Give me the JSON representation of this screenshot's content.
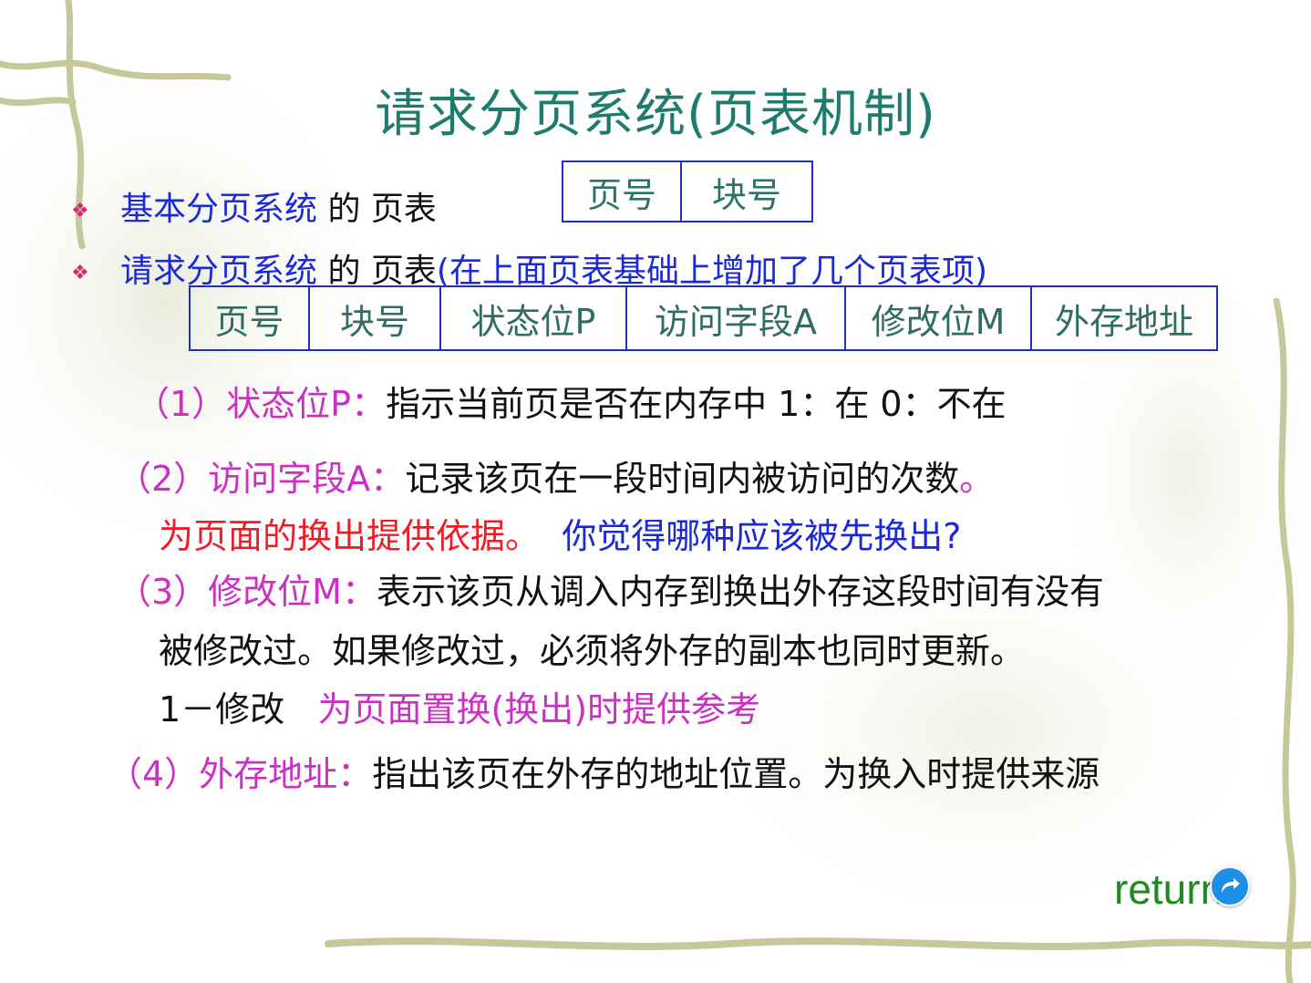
{
  "title": "请求分页系统(页表机制)",
  "bullets": [
    {
      "name": "基本分页系统",
      "connector": " 的 ",
      "item": "页表",
      "note": ""
    },
    {
      "name": "请求分页系统",
      "connector": " 的 ",
      "item": "页表",
      "note": "(在上面页表基础上增加了几个页表项)"
    }
  ],
  "basic_table": [
    "页号",
    "块号"
  ],
  "request_table": [
    "页号",
    "块号",
    "状态位P",
    "访问字段A",
    "修改位M",
    "外存地址"
  ],
  "items": {
    "p1_label": "（1）状态位P：",
    "p1_text": "指示当前页是否在内存中  1：在   0：不在",
    "p2_label": "（2）访问字段A：",
    "p2_text": "记录该页在一段时间内被访问的次数",
    "p2_end": "。",
    "p2_red": "为页面的换出提供依据。",
    "p2_blue": "你觉得哪种应该被先换出?",
    "p3_label": "（3）修改位M：",
    "p3_text1": "表示该页从调入内存到换出外存这段时间有没有",
    "p3_text2": "被修改过。如果修改过，必须将外存的副本也同时更新。",
    "p3_text3": "1－修改",
    "p3_magenta": "为页面置换(换出)时提供参考",
    "p4_label": "（4）外存地址：",
    "p4_text": "指出该页在外存的地址位置。为换入时提供来源"
  },
  "return_label": "return",
  "icon": "return-arrow-icon",
  "colors": {
    "title": "#1e7b6e",
    "blue": "#1c2ad6",
    "magenta": "#cc2fc3",
    "red": "#ee1c25",
    "green": "#1f8a1f"
  }
}
